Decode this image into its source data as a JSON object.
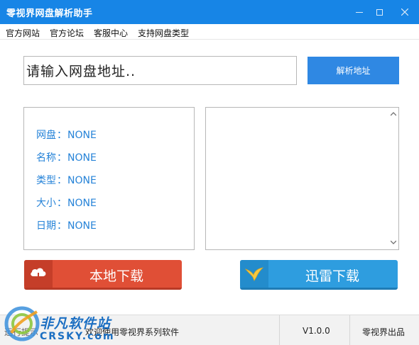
{
  "window": {
    "title": "零视界网盘解析助手"
  },
  "menu": {
    "items": [
      "官方网站",
      "官方论坛",
      "客服中心",
      "支持网盘类型"
    ]
  },
  "input": {
    "value": "请输入网盘地址.."
  },
  "buttons": {
    "parse": "解析地址",
    "local_download": "本地下载",
    "thunder_download": "迅雷下载"
  },
  "info": {
    "rows": [
      {
        "key": "网盘",
        "sep": "：",
        "value": "NONE"
      },
      {
        "key": "名称",
        "sep": "：",
        "value": "NONE"
      },
      {
        "key": "类型",
        "sep": "：",
        "value": "NONE"
      },
      {
        "key": "大小",
        "sep": "：",
        "value": "NONE"
      },
      {
        "key": "日期",
        "sep": "：",
        "value": "NONE"
      }
    ]
  },
  "status": {
    "left": "运行提示",
    "message": "欢迎使用零视界系列软件",
    "version": "V1.0.0",
    "maker": "零视界出品"
  },
  "watermark": {
    "name": "非凡软件站",
    "domain": "CRSKY.com"
  },
  "colors": {
    "titlebar": "#1785e6",
    "accent_blue": "#2f88e3",
    "local_red": "#e04f36",
    "thunder_blue": "#2e9ddf",
    "info_text": "#2683d8"
  },
  "icons": {
    "local": "cloud-download-icon",
    "thunder": "thunder-bird-icon"
  }
}
